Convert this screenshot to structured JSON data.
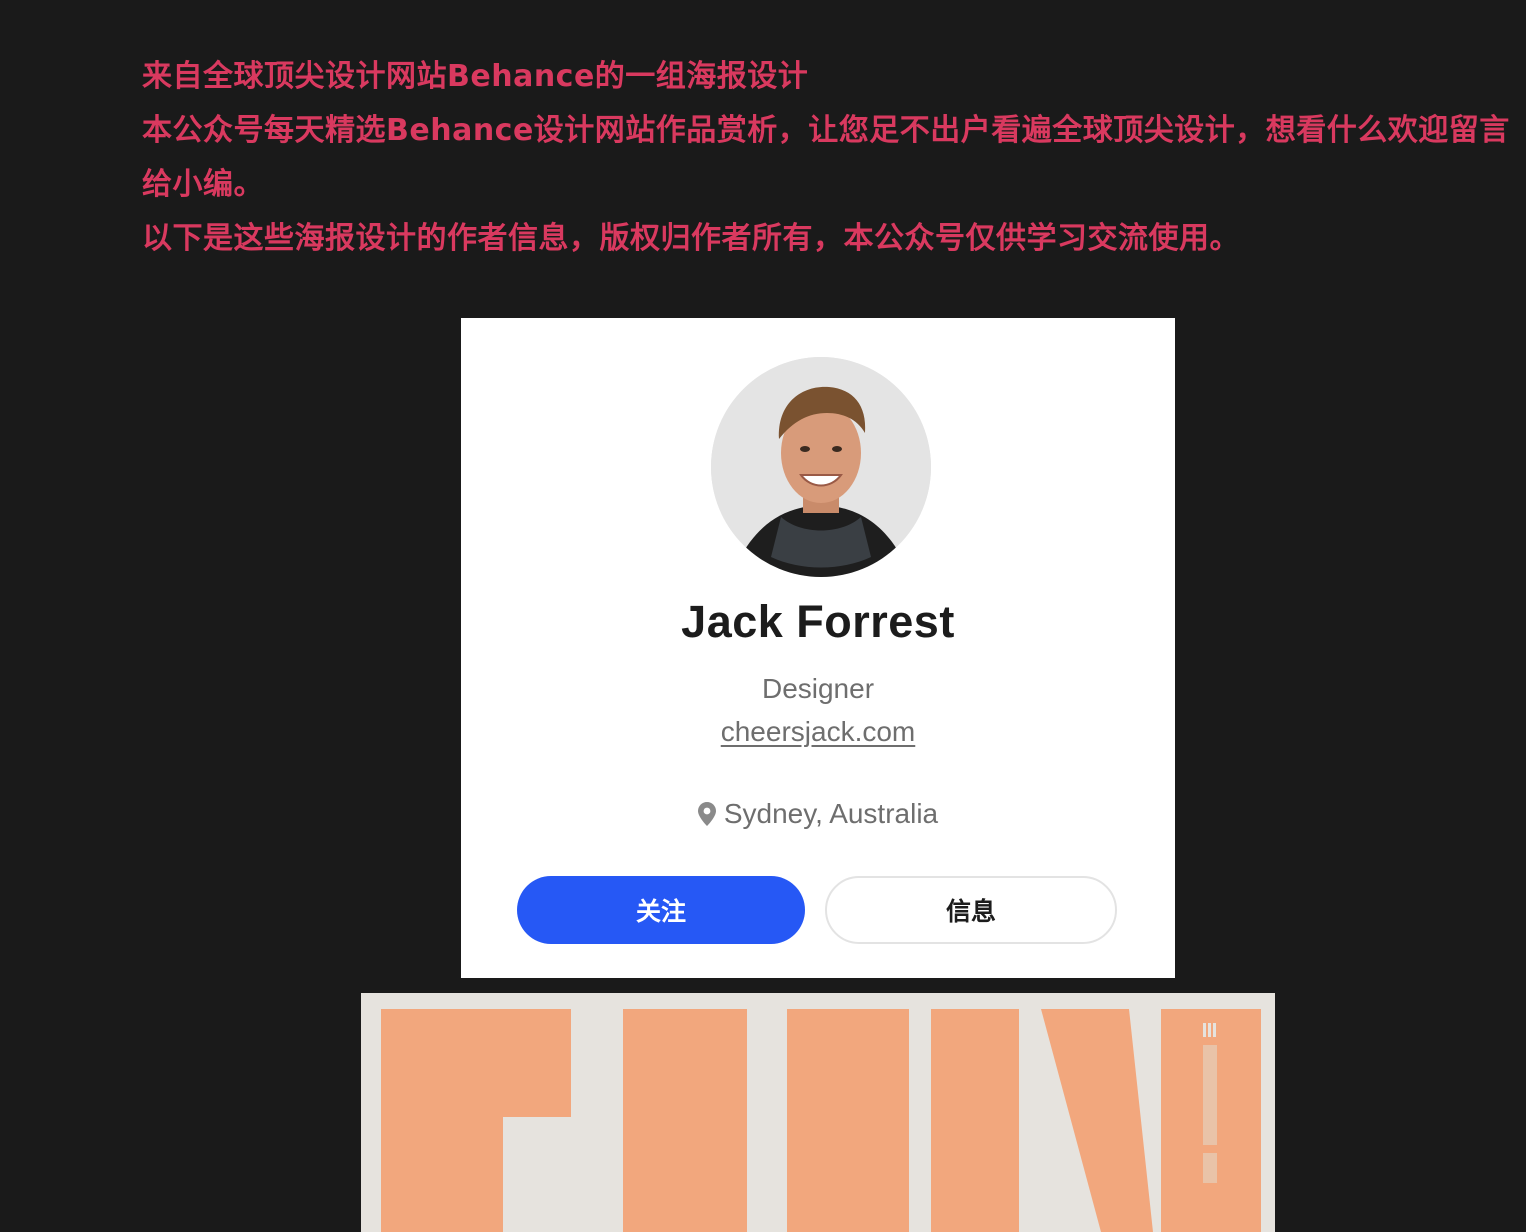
{
  "intro": {
    "line1": "来自全球顶尖设计网站Behance的一组海报设计",
    "line2": "本公众号每天精选Behance设计网站作品赏析，让您足不出户看遍全球顶尖设计，想看什么欢迎留言给小编。",
    "line3": "以下是这些海报设计的作者信息，版权归作者所有，本公众号仅供学习交流使用。"
  },
  "profile": {
    "name": "Jack Forrest",
    "role": "Designer",
    "website": "cheersjack.com",
    "location": "Sydney, Australia",
    "follow_label": "关注",
    "message_label": "信息",
    "accent_color": "#2658f5"
  },
  "icons": {
    "location": "map-pin-icon"
  },
  "colors": {
    "intro_text": "#d9395f",
    "background": "#1a1a1a",
    "poster_orange": "#f2a77d"
  }
}
